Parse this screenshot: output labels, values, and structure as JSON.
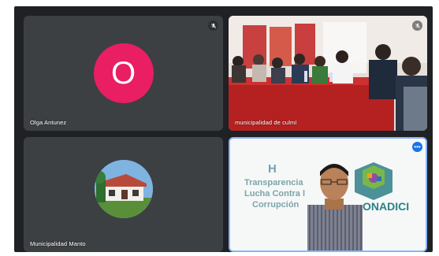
{
  "tiles": [
    {
      "name": "Olga Antunez",
      "avatar_letter": "O",
      "avatar_color": "#e91e63",
      "mic": "mic-off-icon"
    },
    {
      "name": "municipalidad de culmí",
      "mic": "mic-off-icon"
    },
    {
      "name": "Municipalidad Manto"
    },
    {
      "background": {
        "transparency": "Transparencia",
        "lucha": "Lucha Contra l",
        "corrupcion": "Corrupción",
        "logo": "ONADICI"
      }
    }
  ],
  "accent_color": "#8ab4f8"
}
